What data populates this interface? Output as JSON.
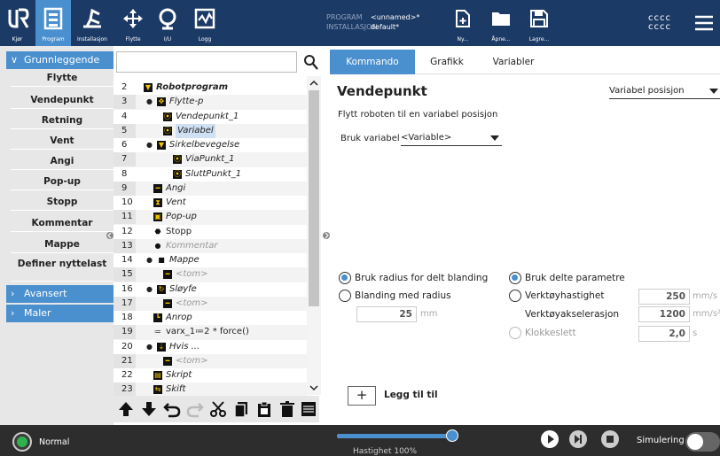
{
  "nav": [
    {
      "label": "Kjør",
      "icon": "ur-logo-icon"
    },
    {
      "label": "Program",
      "icon": "program-icon"
    },
    {
      "label": "Installasjon",
      "icon": "installation-icon"
    },
    {
      "label": "Flytte",
      "icon": "move-icon"
    },
    {
      "label": "I/U",
      "icon": "io-icon"
    },
    {
      "label": "Logg",
      "icon": "log-icon"
    }
  ],
  "file": {
    "program_key": "PROGRAM",
    "program_val": "<unnamed>*",
    "install_key": "INSTALLASJON",
    "install_val": "default*",
    "new_label": "Ny...",
    "open_label": "Åpne...",
    "save_label": "Lagre..."
  },
  "header_right": {
    "line1": "cccc",
    "line2": "cccc"
  },
  "left": {
    "basic_header": "Grunnleggende",
    "items": [
      "Flytte",
      "Vendepunkt",
      "Retning",
      "Vent",
      "Angi",
      "Pop-up",
      "Stopp",
      "Kommentar",
      "Mappe",
      "Definer nyttelast"
    ],
    "advanced_header": "Avansert",
    "templates_header": "Maler"
  },
  "tree": [
    {
      "num": "2",
      "text": "Robotprogram",
      "icon": "program-flag-icon",
      "indent": 0,
      "style": "bold"
    },
    {
      "num": "3",
      "text": "Flytte-p",
      "icon": "move-icon",
      "indent": 1,
      "style": "italic",
      "toggle": true
    },
    {
      "num": "4",
      "text": "Vendepunkt_1",
      "icon": "waypoint-icon",
      "indent": 2,
      "style": "italic"
    },
    {
      "num": "5",
      "text": "Variabel",
      "icon": "waypoint-icon",
      "indent": 2,
      "style": "selected"
    },
    {
      "num": "6",
      "text": "Sirkelbevegelse",
      "icon": "program-flag-icon",
      "indent": 1,
      "style": "italic",
      "toggle": true
    },
    {
      "num": "7",
      "text": "ViaPunkt_1",
      "icon": "waypoint-icon",
      "indent": 3,
      "style": "italic"
    },
    {
      "num": "8",
      "text": "SluttPunkt_1",
      "icon": "waypoint-icon",
      "indent": 3,
      "style": "italic"
    },
    {
      "num": "9",
      "text": "Angi",
      "icon": "set-icon",
      "indent": 1,
      "style": "italic"
    },
    {
      "num": "10",
      "text": "Vent",
      "icon": "hourglass-icon",
      "indent": 1,
      "style": "italic"
    },
    {
      "num": "11",
      "text": "Pop-up",
      "icon": "popup-icon",
      "indent": 1,
      "style": "italic"
    },
    {
      "num": "12",
      "text": "Stopp",
      "icon": "stop-icon",
      "indent": 1,
      "style": "normal"
    },
    {
      "num": "13",
      "text": "Kommentar",
      "icon": "comment-icon",
      "indent": 1,
      "style": "grey"
    },
    {
      "num": "14",
      "text": "Mappe",
      "icon": "folder-icon",
      "indent": 1,
      "style": "italic",
      "toggle": true
    },
    {
      "num": "15",
      "text": "<tom>",
      "icon": "empty-icon",
      "indent": 2,
      "style": "grey"
    },
    {
      "num": "16",
      "text": "Sløyfe",
      "icon": "loop-icon",
      "indent": 1,
      "style": "italic",
      "toggle": true
    },
    {
      "num": "17",
      "text": "<tom>",
      "icon": "empty-icon",
      "indent": 2,
      "style": "grey"
    },
    {
      "num": "18",
      "text": "Anrop",
      "icon": "call-icon",
      "indent": 1,
      "style": "italic"
    },
    {
      "num": "19",
      "text": "varx_1≔2 * force()",
      "icon": "assign-icon",
      "indent": 1,
      "style": "normal"
    },
    {
      "num": "20",
      "text": "Hvis ...",
      "icon": "if-icon",
      "indent": 1,
      "style": "italic",
      "toggle": true
    },
    {
      "num": "21",
      "text": "<tom>",
      "icon": "empty-icon",
      "indent": 2,
      "style": "grey"
    },
    {
      "num": "22",
      "text": "Skript",
      "icon": "script-icon",
      "indent": 1,
      "style": "italic"
    },
    {
      "num": "23",
      "text": "Skift",
      "icon": "switch-icon",
      "indent": 1,
      "style": "italic"
    }
  ],
  "tabs": [
    "Kommando",
    "Grafikk",
    "Variabler"
  ],
  "command": {
    "title": "Vendepunkt",
    "type_select": "Variabel posisjon",
    "description": "Flytt roboten til en variabel posisjon",
    "use_var_label": "Bruk variabel",
    "use_var_value": "<Variable>",
    "radius_shared": "Bruk radius for delt blanding",
    "blend_radius": "Blanding med radius",
    "blend_value": "25",
    "blend_unit": "mm",
    "shared_params": "Bruk delte parametre",
    "tool_speed": "Verktøyhastighet",
    "tool_speed_value": "250",
    "tool_speed_unit": "mm/s",
    "tool_accel": "Verktøyakselerasjon",
    "tool_accel_value": "1200",
    "tool_accel_unit": "mm/s²",
    "time": "Klokkeslett",
    "time_value": "2,0",
    "time_unit": "s",
    "add_label": "Legg til til"
  },
  "bottom": {
    "status": "Normal",
    "speed": "Hastighet 100%",
    "speed_fraction": 1.0,
    "sim_label": "Simulering"
  },
  "colors": {
    "header": "#1c3a66",
    "accent": "#4a90cf",
    "bottom": "#2d2d2d"
  }
}
